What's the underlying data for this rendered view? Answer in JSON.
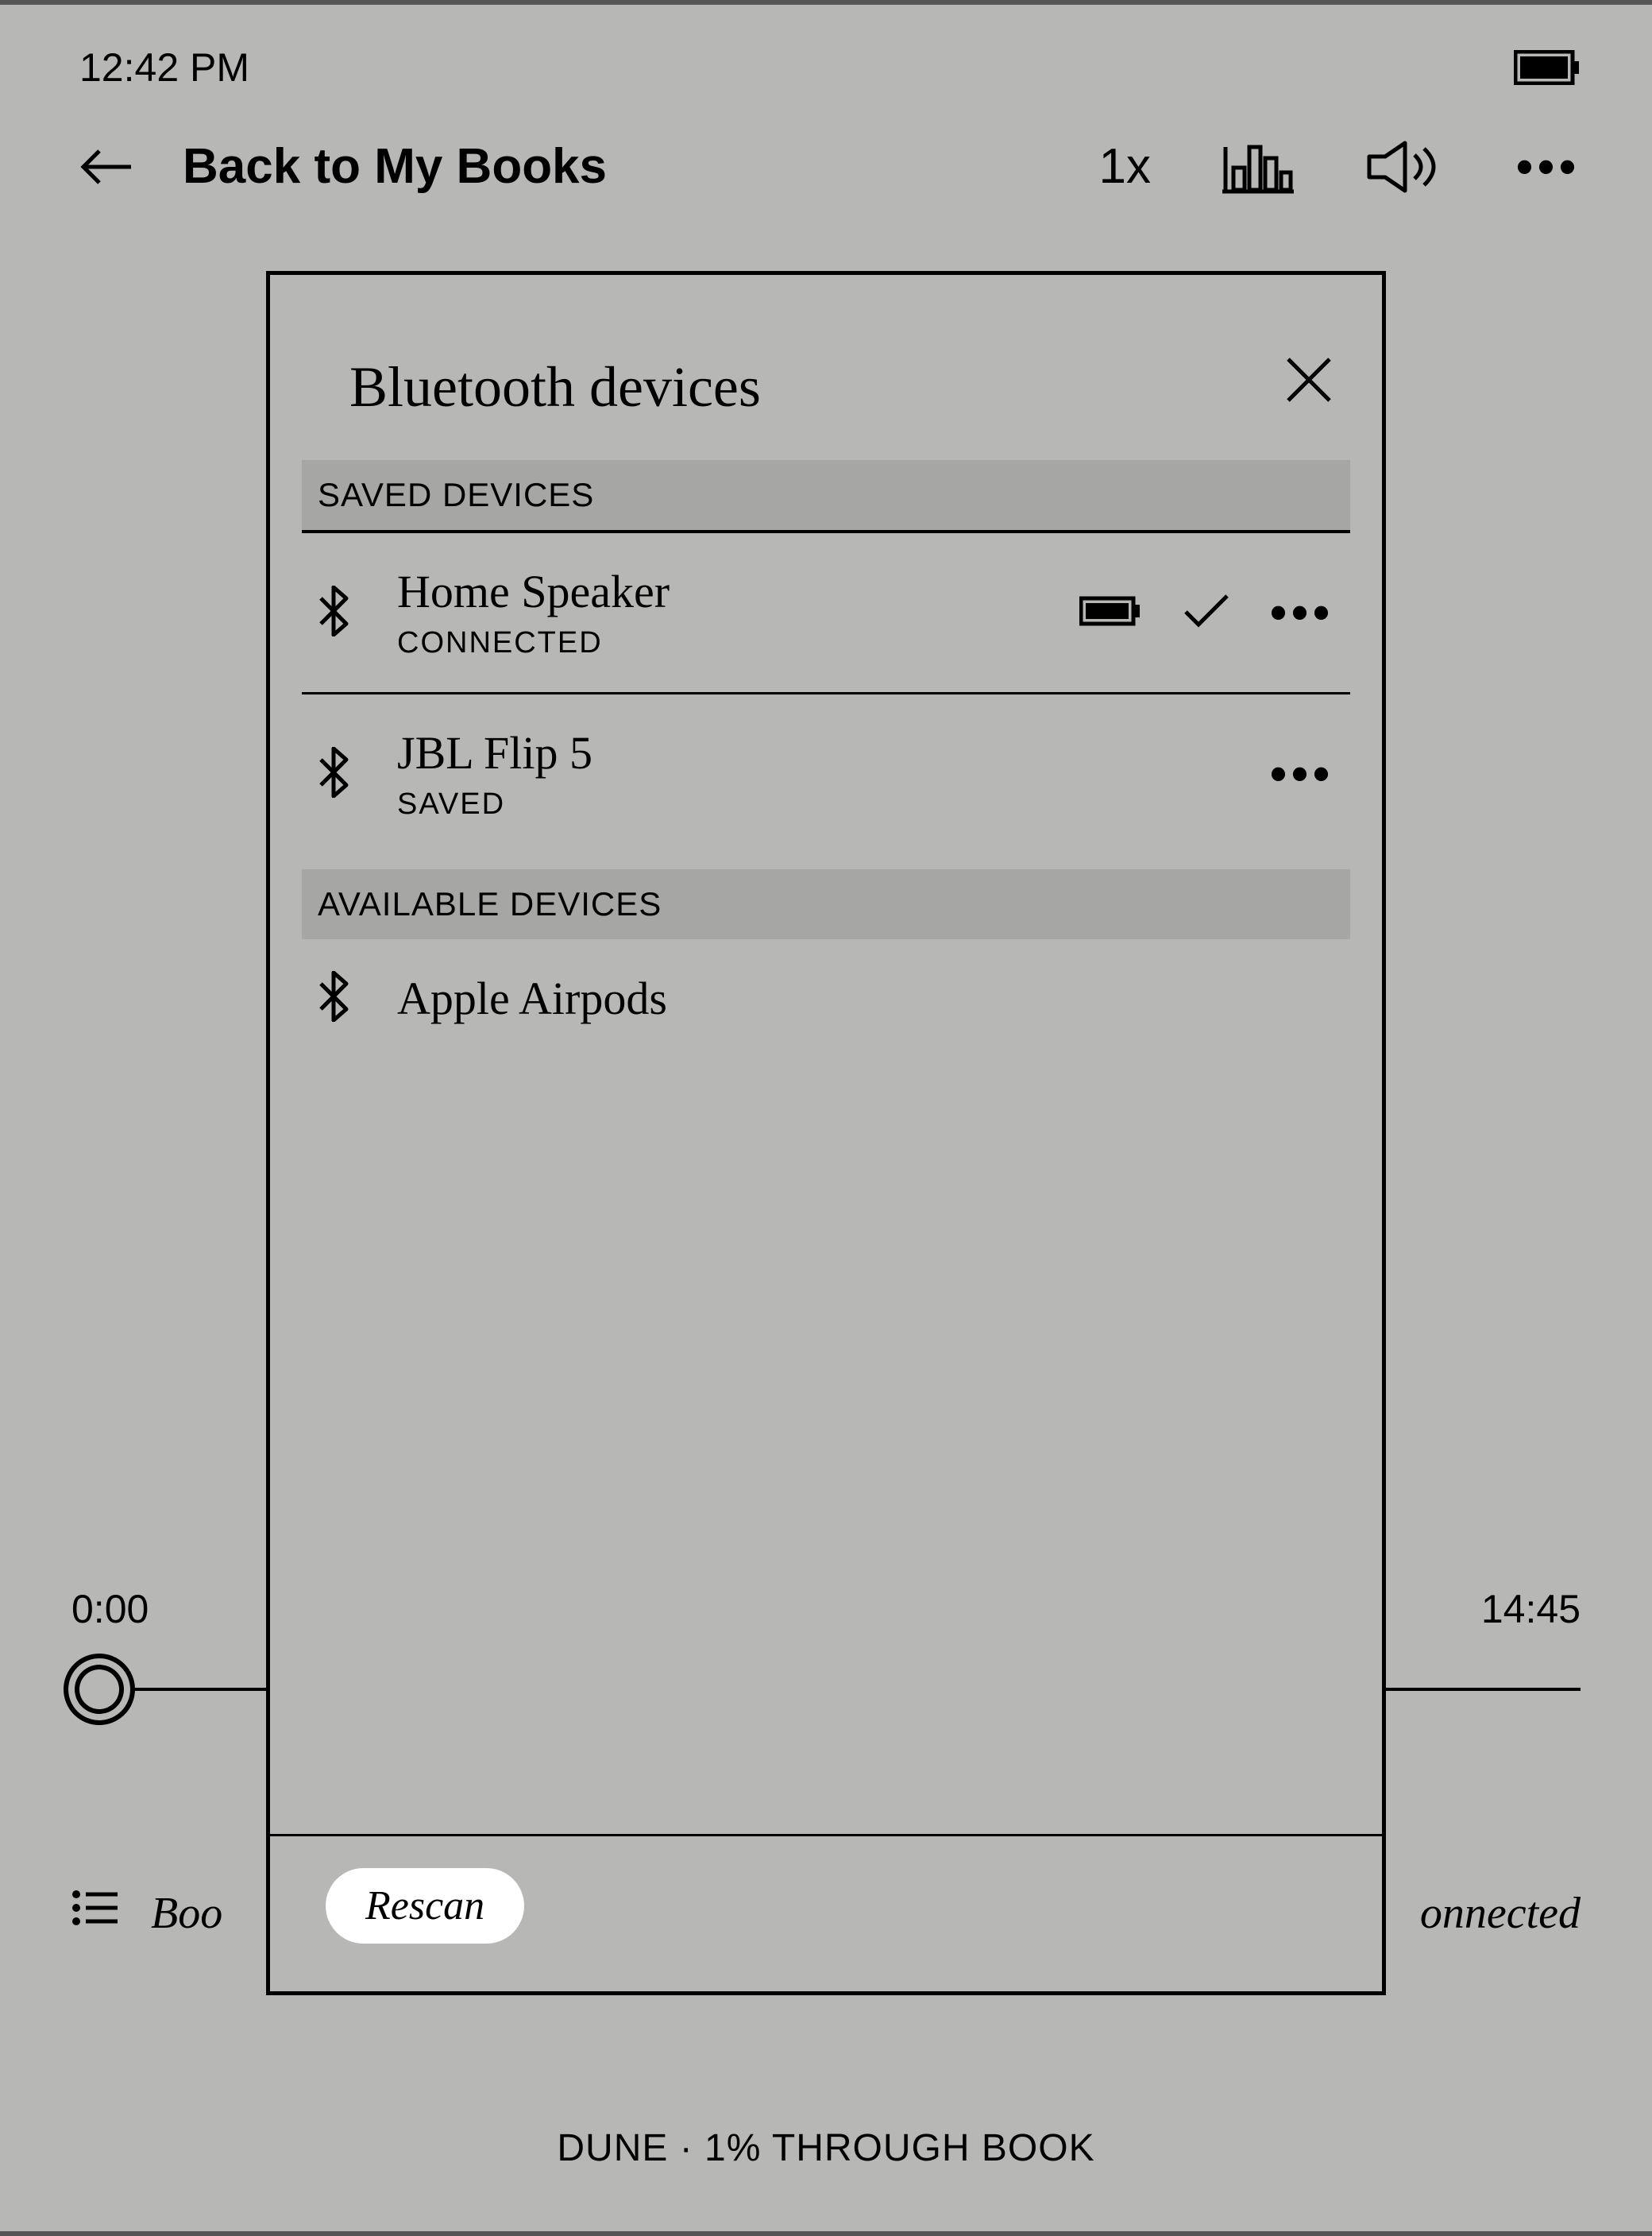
{
  "status": {
    "time": "12:42 PM"
  },
  "nav": {
    "back_label": "Back to My Books",
    "speed": "1x"
  },
  "player": {
    "elapsed": "0:00",
    "remaining": "14:45",
    "bottom_left": "Boo",
    "bottom_right": "onnected"
  },
  "footer": "DUNE · 1% THROUGH BOOK",
  "modal": {
    "title": "Bluetooth devices",
    "saved_header": "SAVED DEVICES",
    "available_header": "AVAILABLE DEVICES",
    "saved": [
      {
        "name": "Home Speaker",
        "status": "CONNECTED",
        "battery": true,
        "check": true
      },
      {
        "name": "JBL Flip 5",
        "status": "SAVED",
        "battery": false,
        "check": false
      }
    ],
    "available": [
      {
        "name": "Apple Airpods"
      }
    ],
    "rescan": "Rescan"
  }
}
